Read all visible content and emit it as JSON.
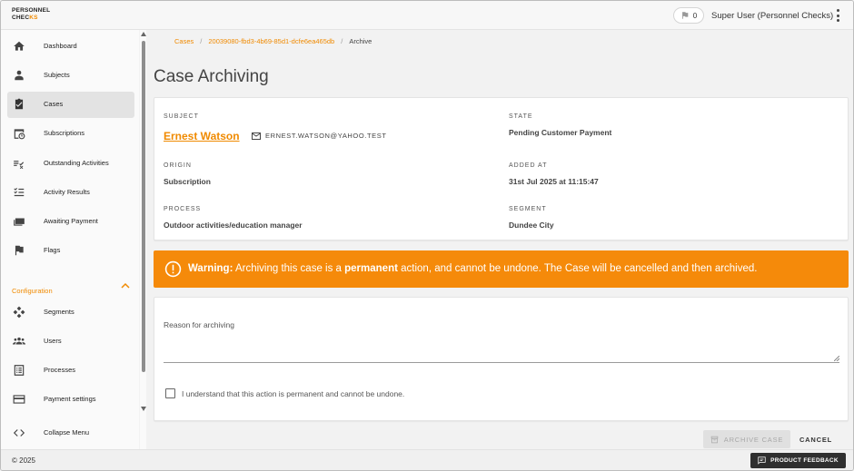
{
  "brand": {
    "logo_line1": "PERSONNEL",
    "logo_line2a": "CHEC",
    "logo_line2b": "KS",
    "accent_color": "#f08a00"
  },
  "header": {
    "flag_count": "0",
    "user_name": "Super User (Personnel Checks)"
  },
  "sidebar": {
    "items": [
      {
        "label": "Dashboard",
        "icon": "home-icon"
      },
      {
        "label": "Subjects",
        "icon": "person-icon"
      },
      {
        "label": "Cases",
        "icon": "clipboard-check-icon"
      },
      {
        "label": "Subscriptions",
        "icon": "calendar-clock-icon"
      },
      {
        "label": "Outstanding Activities",
        "icon": "list-check-icon"
      },
      {
        "label": "Activity Results",
        "icon": "checklist-icon"
      },
      {
        "label": "Awaiting Payment",
        "icon": "payments-icon"
      },
      {
        "label": "Flags",
        "icon": "flag-icon"
      }
    ],
    "config_label": "Configuration",
    "config_items": [
      {
        "label": "Segments",
        "icon": "diamonds-icon"
      },
      {
        "label": "Users",
        "icon": "group-icon"
      },
      {
        "label": "Processes",
        "icon": "list-alt-icon"
      },
      {
        "label": "Payment settings",
        "icon": "credit-card-icon"
      }
    ],
    "collapse_label": "Collapse Menu"
  },
  "breadcrumb": {
    "cases": "Cases",
    "case_id": "20039080-fbd3-4b69-85d1-dcfe6ea465db",
    "sep": "/",
    "current": "Archive"
  },
  "page_title": "Case Archiving",
  "case": {
    "subject_label": "SUBJECT",
    "subject_name": "Ernest Watson",
    "subject_email": "ERNEST.WATSON@YAHOO.TEST",
    "state_label": "STATE",
    "state_value": "Pending Customer Payment",
    "origin_label": "ORIGIN",
    "origin_value": "Subscription",
    "added_label": "ADDED AT",
    "added_value": "31st Jul 2025 at 11:15:47",
    "process_label": "PROCESS",
    "process_value": "Outdoor activities/education manager",
    "segment_label": "SEGMENT",
    "segment_value": "Dundee City"
  },
  "warning": {
    "title": "Warning:",
    "text_before": "Archiving this case is a",
    "emphasis": "permanent",
    "text_after": "action, and cannot be undone. The Case will be cancelled and then archived.",
    "color": "#f58a0a"
  },
  "form": {
    "reason_label": "Reason for archiving",
    "reason_value": "",
    "confirm_label": "I understand that this action is permanent and cannot be undone.",
    "confirm_checked": false
  },
  "actions": {
    "archive_label": "ARCHIVE CASE",
    "cancel_label": "CANCEL"
  },
  "footer": {
    "copyright": "© 2025",
    "feedback_label": "PRODUCT FEEDBACK"
  }
}
